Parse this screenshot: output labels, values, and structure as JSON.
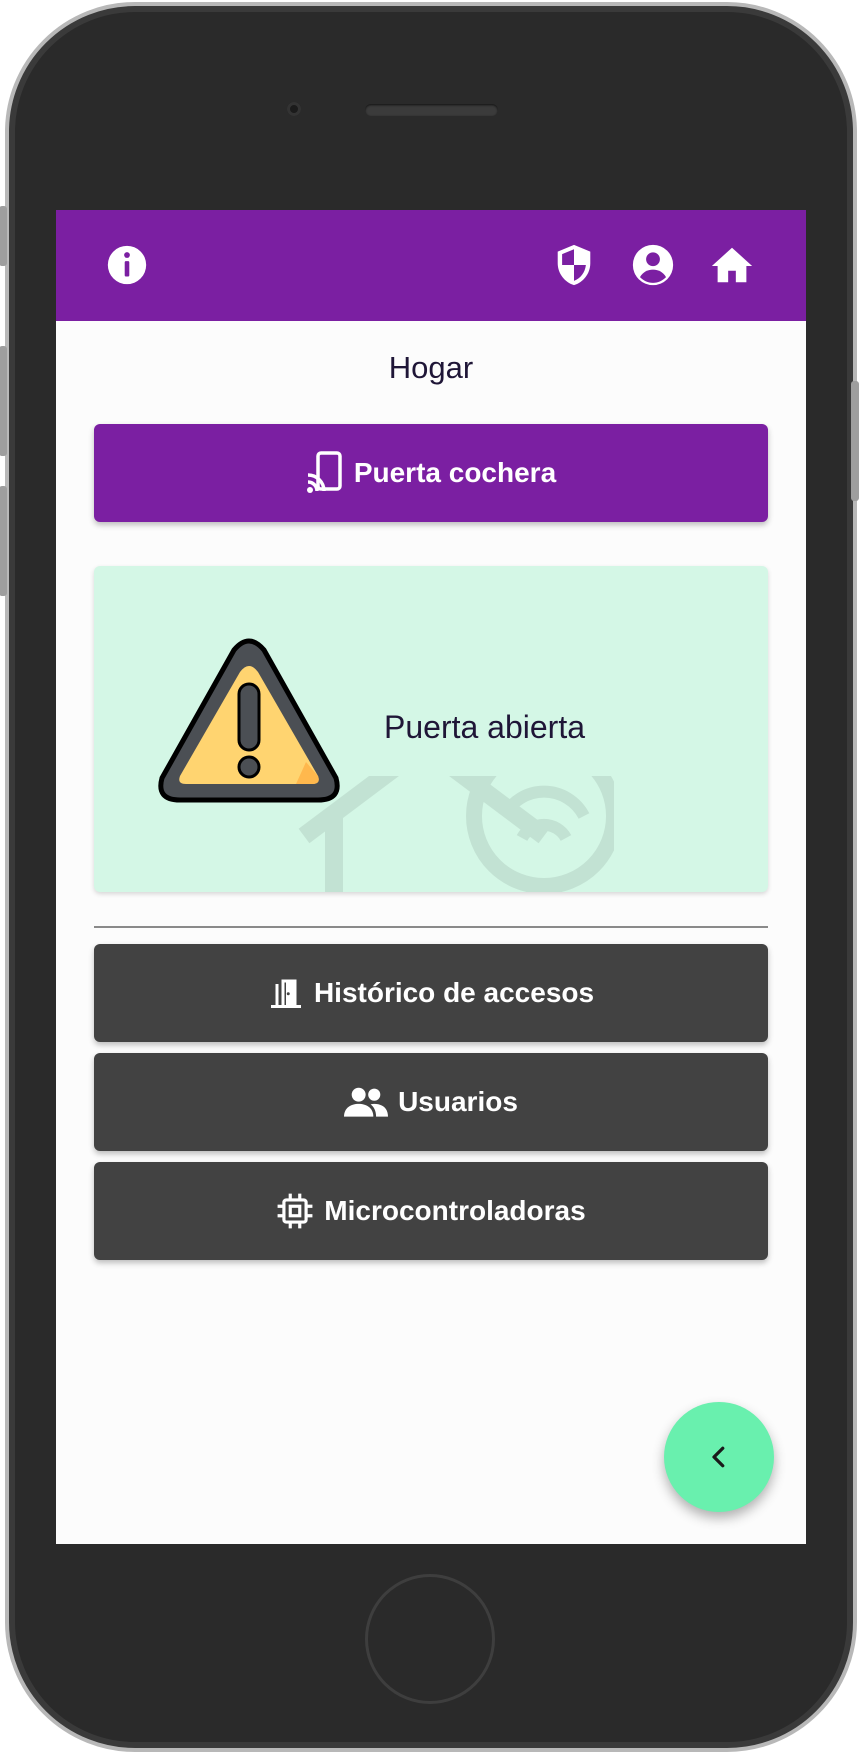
{
  "header": {
    "icons": [
      "info-icon",
      "shield-icon",
      "account-circle-icon",
      "home-icon"
    ],
    "background": "#7b1fa2"
  },
  "page": {
    "title": "Hogar"
  },
  "primary_action": {
    "label": "Puerta cochera",
    "icon": "cast-phone-icon",
    "color": "#7b1fa2"
  },
  "status": {
    "text": "Puerta abierta",
    "icon": "warning-icon",
    "background": "#d4f7e6"
  },
  "menu": {
    "items": [
      {
        "label": "Histórico de accesos",
        "icon": "door-icon"
      },
      {
        "label": "Usuarios",
        "icon": "people-icon"
      },
      {
        "label": "Microcontroladoras",
        "icon": "chip-icon"
      }
    ],
    "color": "#424242"
  },
  "fab": {
    "icon": "chevron-left-icon",
    "color": "#69f0ae"
  }
}
